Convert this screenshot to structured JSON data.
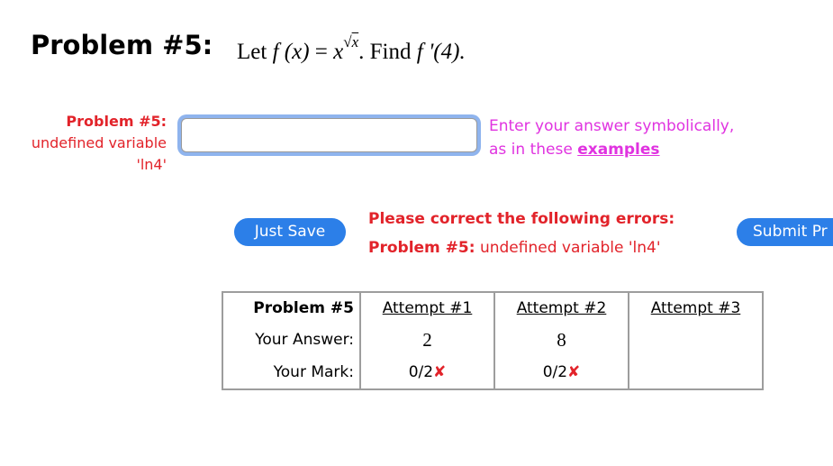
{
  "header": {
    "title": "Problem #5:",
    "statement": {
      "let": "Let",
      "fx": "f (x)",
      "equals": "=",
      "base": "x",
      "exponent": "x",
      "find": ". Find",
      "target": "f '(4)."
    }
  },
  "error_label": {
    "problem": "Problem #5:",
    "line1": "undefined variable",
    "line2": "'ln4'"
  },
  "answer": {
    "value": "",
    "placeholder": ""
  },
  "hint": {
    "line1": "Enter your answer symbolically,",
    "line2_prefix": "as in these",
    "link": "examples"
  },
  "buttons": {
    "just_save": "Just Save",
    "submit": "Submit Pr"
  },
  "errors": {
    "title": "Please correct the following errors:",
    "problem": "Problem #5:",
    "message": "undefined variable 'ln4'"
  },
  "attempts_table": {
    "header": "Problem #5",
    "attempt_labels": [
      "Attempt #1",
      "Attempt #2",
      "Attempt #3"
    ],
    "answer_row_label": "Your Answer:",
    "answers": [
      "2",
      "8",
      ""
    ],
    "mark_row_label": "Your Mark:",
    "marks": [
      "0/2",
      "0/2",
      ""
    ],
    "mark_symbol": "✘"
  },
  "colors": {
    "error": "#e2232a",
    "hint": "#e033e0",
    "button": "#2c7fe8",
    "input_focus": "#8fb4ee"
  }
}
